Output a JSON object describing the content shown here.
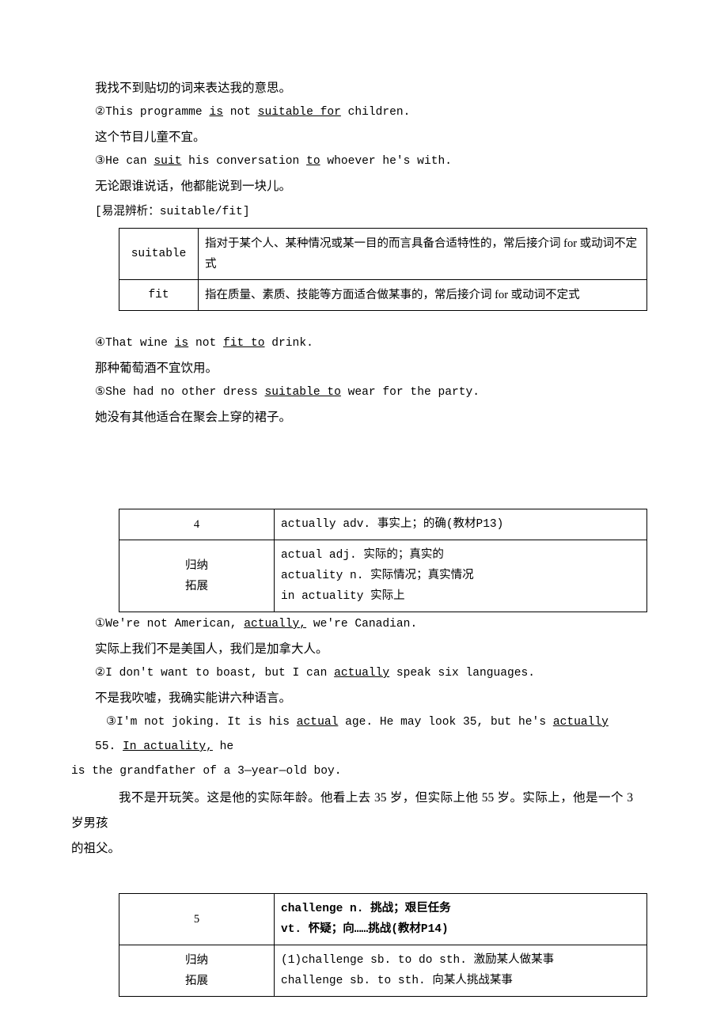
{
  "section_suit": {
    "lines": [
      {
        "id": "l1",
        "type": "cn",
        "text": "我找不到贴切的词来表达我的意思。"
      },
      {
        "id": "l2",
        "type": "en",
        "pre": "②This programme ",
        "u1": "is",
        "mid1": " not ",
        "u2": "suitable for",
        "post": " children."
      },
      {
        "id": "l3",
        "type": "cn",
        "text": "这个节目儿童不宜。"
      },
      {
        "id": "l4",
        "type": "en",
        "pre": "③He can ",
        "u1": "suit",
        "mid1": " his conversation ",
        "u2": "to",
        "post": " whoever he's with."
      },
      {
        "id": "l5",
        "type": "cn",
        "text": "无论跟谁说话，他都能说到一块儿。"
      }
    ],
    "bracket": "[易混辨析：suitable/fit]",
    "table": [
      {
        "term": "suitable",
        "desc": "指对于某个人、某种情况或某一目的而言具备合适特性的，常后接介词 for 或动词不定式"
      },
      {
        "term": "fit",
        "desc": "指在质量、素质、技能等方面适合做某事的，常后接介词 for 或动词不定式"
      }
    ],
    "lines_after": [
      {
        "id": "l6",
        "type": "en",
        "pre": "④That wine ",
        "u1": "is",
        "mid1": " not ",
        "u2": "fit to",
        "post": " drink."
      },
      {
        "id": "l7",
        "type": "cn",
        "text": "那种葡萄酒不宜饮用。"
      },
      {
        "id": "l8",
        "type": "en",
        "pre": "⑤She had no other dress ",
        "u1": "suitable to",
        "mid1": "",
        "u2": "",
        "post": " wear for the party."
      },
      {
        "id": "l9",
        "type": "cn",
        "text": "她没有其他适合在聚会上穿的裙子。"
      }
    ]
  },
  "entry_actually": {
    "number": "4",
    "headword": "actually adv. 事实上；的确(教材P13)",
    "label_line1": "归纳",
    "label_line2": "拓展",
    "expansion": [
      "actual adj. 实际的；真实的",
      "actuality n. 实际情况；真实情况",
      "in actuality 实际上"
    ],
    "examples": [
      {
        "id": "e1",
        "pre": "①We're not American, ",
        "u1": "actually,",
        "post": " we're Canadian."
      },
      {
        "id": "e2",
        "type": "cn",
        "text": "实际上我们不是美国人，我们是加拿大人。"
      },
      {
        "id": "e3",
        "pre": "②I don't want to boast, but I can ",
        "u1": "actually",
        "post": " speak six languages."
      },
      {
        "id": "e4",
        "type": "cn",
        "text": "不是我吹嘘，我确实能讲六种语言。"
      }
    ],
    "long_example_l1_a": "③I'm not joking. It is his ",
    "long_example_l1_u1": "actual",
    "long_example_l1_b": " age. He may look 35, but he's ",
    "long_example_l1_u2": "actually",
    "long_example_l1_c": " 55. ",
    "long_example_l1_u3": "In actuality,",
    "long_example_l1_d": " he",
    "long_example_l2": "is the grandfather of a 3—year—old boy.",
    "translation_l1": "我不是开玩笑。这是他的实际年龄。他看上去 35 岁，但实际上他 55 岁。实际上，他是一个 3 岁男孩",
    "translation_l2": "的祖父。"
  },
  "entry_challenge": {
    "number": "5",
    "headword_line1": "challenge n. 挑战；艰巨任务",
    "headword_line2": "vt. 怀疑；向……挑战(教材P14)",
    "label_line1": "归纳",
    "label_line2": "拓展",
    "expansion": [
      "(1)challenge sb. to do sth. 激励某人做某事",
      "challenge sb. to sth. 向某人挑战某事"
    ]
  }
}
